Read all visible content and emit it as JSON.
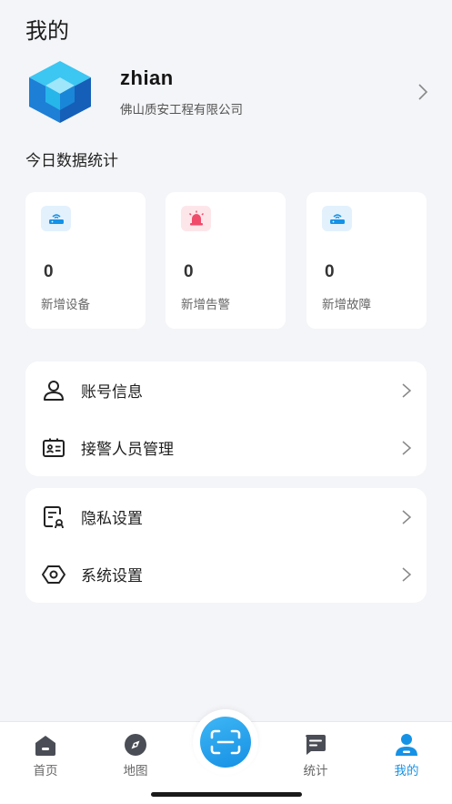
{
  "header": {
    "title": "我的"
  },
  "profile": {
    "username": "zhian",
    "company": "佛山质安工程有限公司"
  },
  "stats": {
    "section_title": "今日数据统计",
    "cards": [
      {
        "value": "0",
        "label": "新增设备",
        "icon": "router-icon",
        "icon_bg": "#e3f1fd",
        "icon_color": "#1592e6"
      },
      {
        "value": "0",
        "label": "新增告警",
        "icon": "alarm-light-icon",
        "icon_bg": "#fde6ea",
        "icon_color": "#f04b6b"
      },
      {
        "value": "0",
        "label": "新增故障",
        "icon": "router-icon",
        "icon_bg": "#e3f1fd",
        "icon_color": "#1592e6"
      }
    ]
  },
  "menu": {
    "group1": [
      {
        "label": "账号信息",
        "icon": "user-icon"
      },
      {
        "label": "接警人员管理",
        "icon": "id-card-icon"
      }
    ],
    "group2": [
      {
        "label": "隐私设置",
        "icon": "privacy-icon"
      },
      {
        "label": "系统设置",
        "icon": "settings-icon"
      }
    ]
  },
  "tabbar": {
    "tabs": [
      {
        "label": "首页",
        "icon": "home-icon",
        "active": false
      },
      {
        "label": "地图",
        "icon": "compass-icon",
        "active": false
      },
      {
        "label": "统计",
        "icon": "chat-icon",
        "active": false
      },
      {
        "label": "我的",
        "icon": "person-icon",
        "active": true
      }
    ],
    "scan_icon": "scan-icon"
  },
  "colors": {
    "accent": "#1592e6",
    "background": "#f4f5f8",
    "alert": "#f04b6b"
  }
}
